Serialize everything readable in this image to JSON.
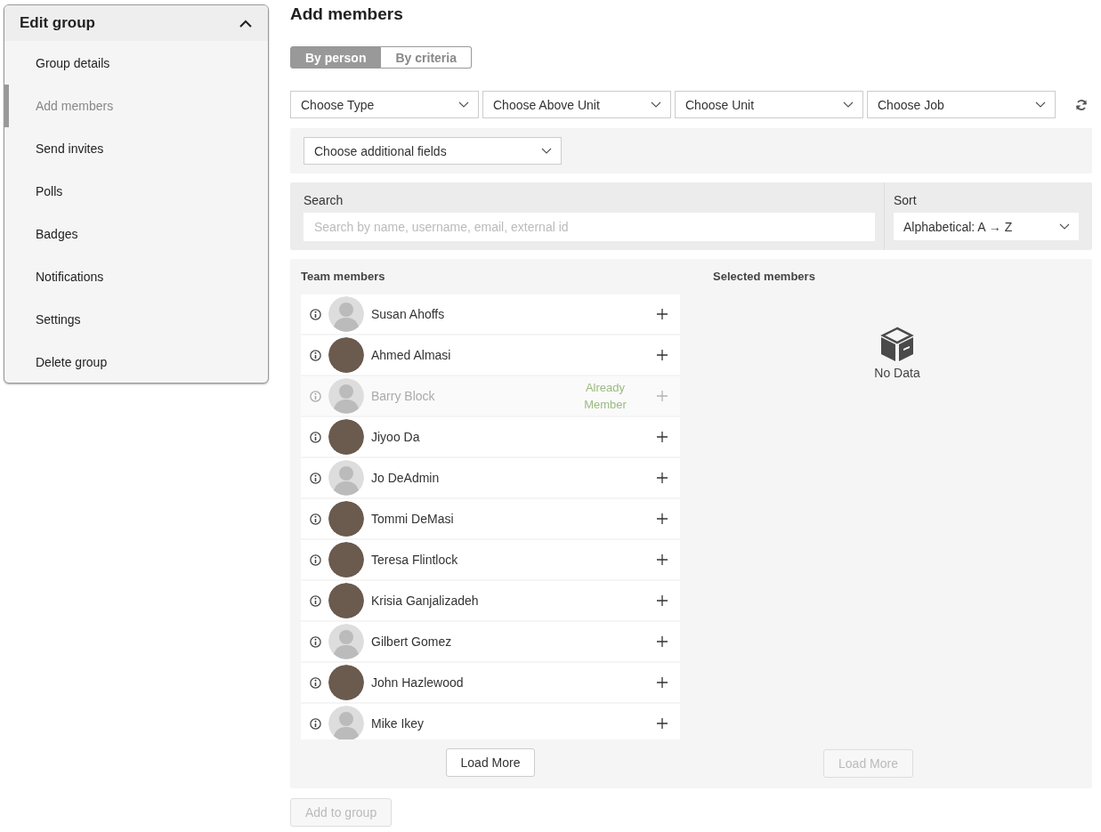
{
  "sidebar": {
    "title": "Edit group",
    "expanded": true,
    "items": [
      {
        "label": "Group details",
        "selected": false
      },
      {
        "label": "Add members",
        "selected": true
      },
      {
        "label": "Send invites",
        "selected": false
      },
      {
        "label": "Polls",
        "selected": false
      },
      {
        "label": "Badges",
        "selected": false
      },
      {
        "label": "Notifications",
        "selected": false
      },
      {
        "label": "Settings",
        "selected": false
      },
      {
        "label": "Delete group",
        "selected": false
      }
    ]
  },
  "title": "Add members",
  "mode_tabs": [
    {
      "label": "By person",
      "selected": true
    },
    {
      "label": "By criteria",
      "selected": false
    }
  ],
  "filters": [
    "Choose Type",
    "Choose Above Unit",
    "Choose Unit",
    "Choose Job"
  ],
  "additional_fields": "Choose additional fields",
  "search": {
    "label": "Search",
    "placeholder": "Search by name, username, email, external id"
  },
  "sort": {
    "label": "Sort",
    "value": "Alphabetical: A → Z"
  },
  "team_members": {
    "heading": "Team members",
    "rows": [
      {
        "name": "Susan Ahoffs",
        "kind": "default",
        "already_member": false
      },
      {
        "name": "Ahmed Almasi",
        "kind": "photo",
        "already_member": false
      },
      {
        "name": "Barry Block",
        "kind": "default",
        "already_member": true,
        "status": "Already Member"
      },
      {
        "name": "Jiyoo Da",
        "kind": "photo",
        "already_member": false
      },
      {
        "name": "Jo DeAdmin",
        "kind": "default",
        "already_member": false
      },
      {
        "name": "Tommi DeMasi",
        "kind": "photo",
        "already_member": false
      },
      {
        "name": "Teresa Flintlock",
        "kind": "photo",
        "already_member": false
      },
      {
        "name": "Krisia Ganjalizadeh",
        "kind": "photo",
        "already_member": false
      },
      {
        "name": "Gilbert Gomez",
        "kind": "default",
        "already_member": false
      },
      {
        "name": "John Hazlewood",
        "kind": "photo",
        "already_member": false
      },
      {
        "name": "Mike Ikey",
        "kind": "default",
        "already_member": false
      }
    ],
    "load_more": {
      "label": "Load More",
      "disabled": false
    }
  },
  "selected_members": {
    "heading": "Selected members",
    "empty_text": "No Data",
    "load_more": {
      "label": "Load More",
      "disabled": true
    }
  },
  "add_button": {
    "label": "Add to group",
    "disabled": true
  }
}
